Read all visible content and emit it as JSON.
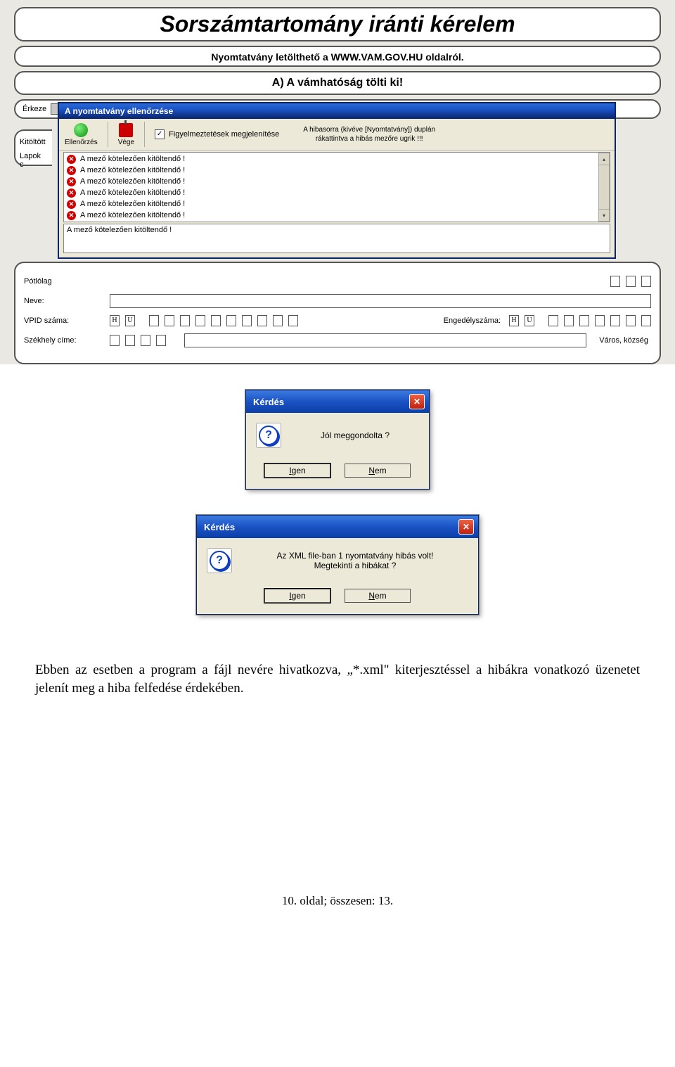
{
  "form": {
    "title": "Sorszámtartomány iránti kérelem",
    "subtitle": "Nyomtatvány letölthető a WWW.VAM.GOV.HU oldalról.",
    "section_a": "A) A vámhatóság tölti ki!",
    "labels": {
      "erkezes": "Érkeze",
      "kitolt": "Kitöltött",
      "lapok": "Lapok c",
      "potlolag": "Pótlólag",
      "neve": "Neve:",
      "vpid": "VPID száma:",
      "vpid_pref1": "H",
      "vpid_pref2": "U",
      "engedely": "Engedélyszáma:",
      "eng_pref1": "H",
      "eng_pref2": "U",
      "szekhely": "Székhely címe:",
      "varos": "Város, község"
    }
  },
  "validation": {
    "window_title": "A nyomtatvány ellenőrzése",
    "btn_check": "Ellenőrzés",
    "btn_end": "Vége",
    "chk_label": "Figyelmeztetések megjelenítése",
    "hint_line1": "A hibasorra (kivéve [Nyomtatvány]) duplán",
    "hint_line2": "rákattintva a hibás  mezőre ugrik !!!",
    "errors": [
      "A mező kötelezően kitöltendő !",
      "A mező kötelezően kitöltendő !",
      "A mező kötelezően kitöltendő !",
      "A mező kötelezően kitöltendő !",
      "A mező kötelezően kitöltendő !",
      "A mező kötelezően kitöltendő !"
    ],
    "status": "A mező kötelezően kitöltendő !"
  },
  "dialog1": {
    "title": "Kérdés",
    "message": "Jól meggondolta ?",
    "yes_u": "I",
    "yes_rest": "gen",
    "no_u": "N",
    "no_rest": "em"
  },
  "dialog2": {
    "title": "Kérdés",
    "message_l1": "Az XML file-ban 1 nyomtatvány hibás volt!",
    "message_l2": "Megtekinti a hibákat ?",
    "yes_u": "I",
    "yes_rest": "gen",
    "no_u": "N",
    "no_rest": "em"
  },
  "doc": {
    "paragraph": "Ebben az esetben a program a fájl nevére hivatkozva, „*.xml\" kiterjesztéssel a hibákra vonatkozó üzenetet jelenít meg a hiba felfedése érdekében.",
    "footer": "10. oldal; összesen: 13."
  }
}
